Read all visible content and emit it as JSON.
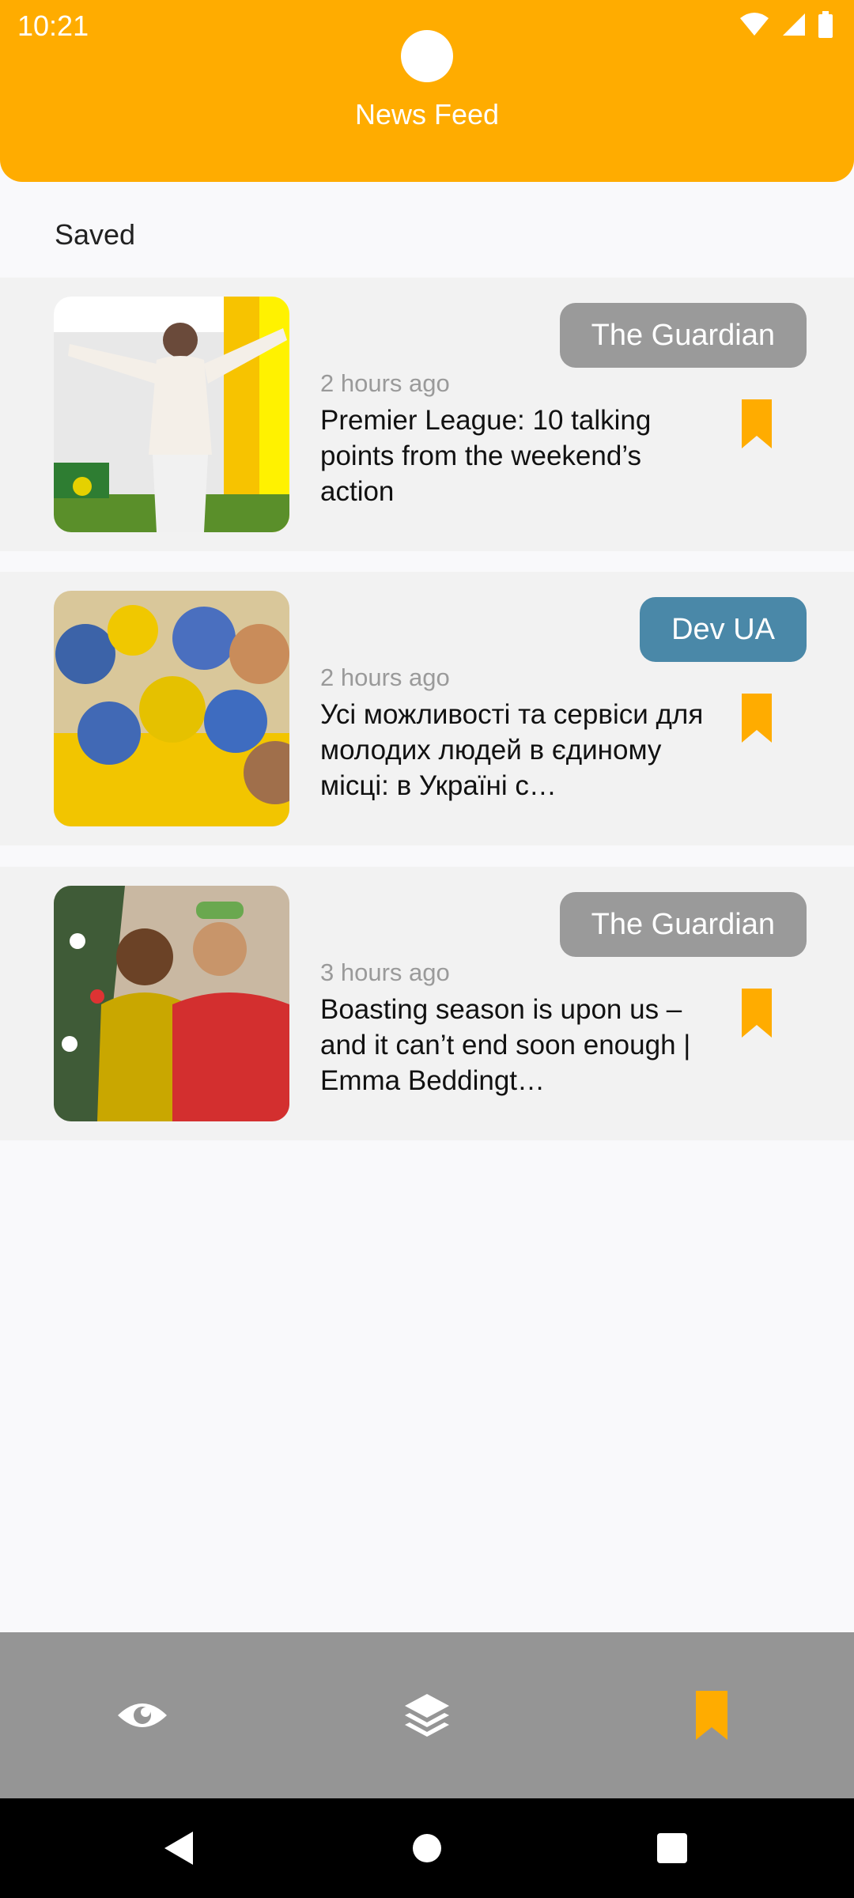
{
  "status_bar": {
    "time": "10:21"
  },
  "header": {
    "title": "News Feed"
  },
  "section": {
    "title": "Saved"
  },
  "articles": [
    {
      "source": "The Guardian",
      "source_color": "#9A9A9A",
      "time": "2 hours ago",
      "title": "Premier League: 10 talking points from the weekend’s action"
    },
    {
      "source": "Dev UA",
      "source_color": "#4A88A8",
      "time": "2 hours ago",
      "title": "Усі можливості та сервіси для молодих людей в єдиному місці: в Україні с…"
    },
    {
      "source": "The Guardian",
      "source_color": "#9A9A9A",
      "time": "3 hours ago",
      "title": "Boasting season is upon us – and it can’t end soon enough | Emma Beddingt…"
    }
  ],
  "bottom_nav": {
    "items": [
      "eye-icon",
      "layers-icon",
      "bookmark-icon"
    ],
    "active_index": 2
  },
  "colors": {
    "accent": "#FFAC00",
    "nav_bg": "#959595"
  }
}
